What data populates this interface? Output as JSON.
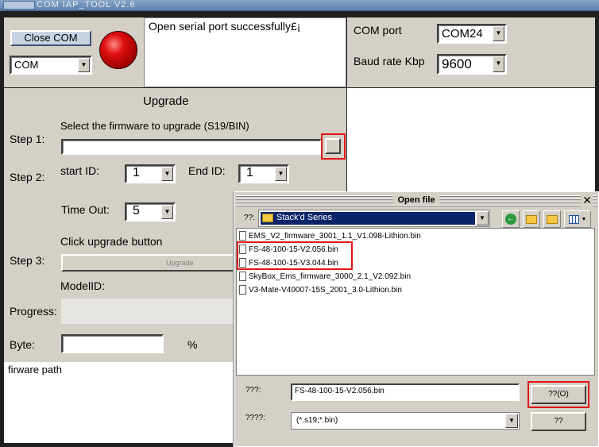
{
  "window": {
    "title": "COM IAP_TOOL V2.6"
  },
  "connection": {
    "close_com_label": "Close COM",
    "com_type": "COM",
    "status_message": "Open serial port successfully£¡",
    "com_port_label": "COM port",
    "com_port_value": "COM24",
    "baud_label": "Baud rate Kbp",
    "baud_value": "9600"
  },
  "upgrade": {
    "heading": "Upgrade",
    "step1_label": "Step 1:",
    "step1_hint": "Select the firmware  to upgrade (S19/BIN)",
    "step2_label": "Step 2:",
    "start_id_label": "start ID:",
    "start_id_value": "1",
    "end_id_label": "End ID:",
    "end_id_value": "1",
    "timeout_label": "Time Out:",
    "timeout_value": "5",
    "click_hint": "Click upgrade button",
    "step3_label": "Step 3:",
    "upgrade_button_label": "Upgrade",
    "model_id_label": "ModelID:",
    "progress_label": "Progress:",
    "byte_label": "Byte:",
    "percent_sign": "%",
    "path_label": "firware path"
  },
  "dialog": {
    "title": "Open file",
    "lookin_label": "??:",
    "folder": "Stack'd Series",
    "files": [
      "EMS_V2_firmware_3001_1.1_V1.098-Lithion.bin",
      "FS-48-100-15-V2.056.bin",
      "FS-48-100-15-V3.044.bin",
      "SkyBox_Ems_firmware_3000_2.1_V2.092.bin",
      "V3-Mate-V40007-15S_2001_3.0-Lithion.bin"
    ],
    "filename_label": "???:",
    "filename_value": "FS-48-100-15-V2.056.bin",
    "filetype_label": "????:",
    "filetype_value": "(*.s19;*.bin)",
    "open_label": "??(O)",
    "cancel_label": "??"
  }
}
